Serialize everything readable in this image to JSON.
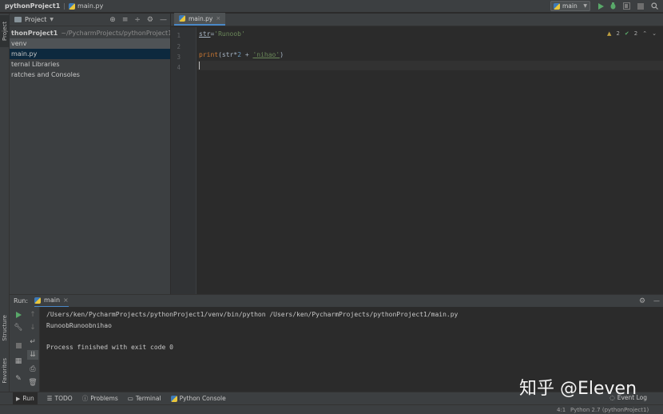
{
  "titlebar": {
    "project": "pythonProject1",
    "file": "main.py",
    "run_config": "main"
  },
  "left_stripe": {
    "project_tab": "Project",
    "structure_tab": "Structure",
    "favorites_tab": "Favorites"
  },
  "project_panel": {
    "title": "Project",
    "tree": [
      {
        "label": "thonProject1",
        "path": "~/PycharmProjects/pythonProject1"
      },
      {
        "label": "venv"
      },
      {
        "label": "main.py"
      },
      {
        "label": "ternal Libraries"
      },
      {
        "label": "ratches and Consoles"
      }
    ]
  },
  "editor": {
    "tab": "main.py",
    "inspections": {
      "warnings": "2",
      "weak": "2"
    },
    "line_numbers": [
      "1",
      "2",
      "3",
      "4"
    ],
    "code": {
      "line1_var": "str",
      "line1_eq": "=",
      "line1_str": "'Runoob'",
      "line3_fn": "print",
      "line3_a": "(str*",
      "line3_num": "2",
      "line3_b": " + ",
      "line3_str": "'nihao'",
      "line3_c": ")"
    }
  },
  "run": {
    "label": "Run:",
    "tab": "main",
    "console": [
      "/Users/ken/PycharmProjects/pythonProject1/venv/bin/python /Users/ken/PycharmProjects/pythonProject1/main.py",
      "RunoobRunoobnihao",
      "",
      "Process finished with exit code 0"
    ]
  },
  "bottom_tabs": {
    "run": "Run",
    "todo": "TODO",
    "problems": "Problems",
    "terminal": "Terminal",
    "python_console": "Python Console",
    "event_log": "Event Log"
  },
  "status": {
    "position": "4:1",
    "interpreter": "Python 2.7 (pythonProject1)"
  },
  "watermark": "知乎 @Eleven",
  "colors": {
    "accent": "#4a88c7",
    "keyword": "#cc7832",
    "string": "#6a8759",
    "number": "#6897bb",
    "run_green": "#59a869"
  }
}
